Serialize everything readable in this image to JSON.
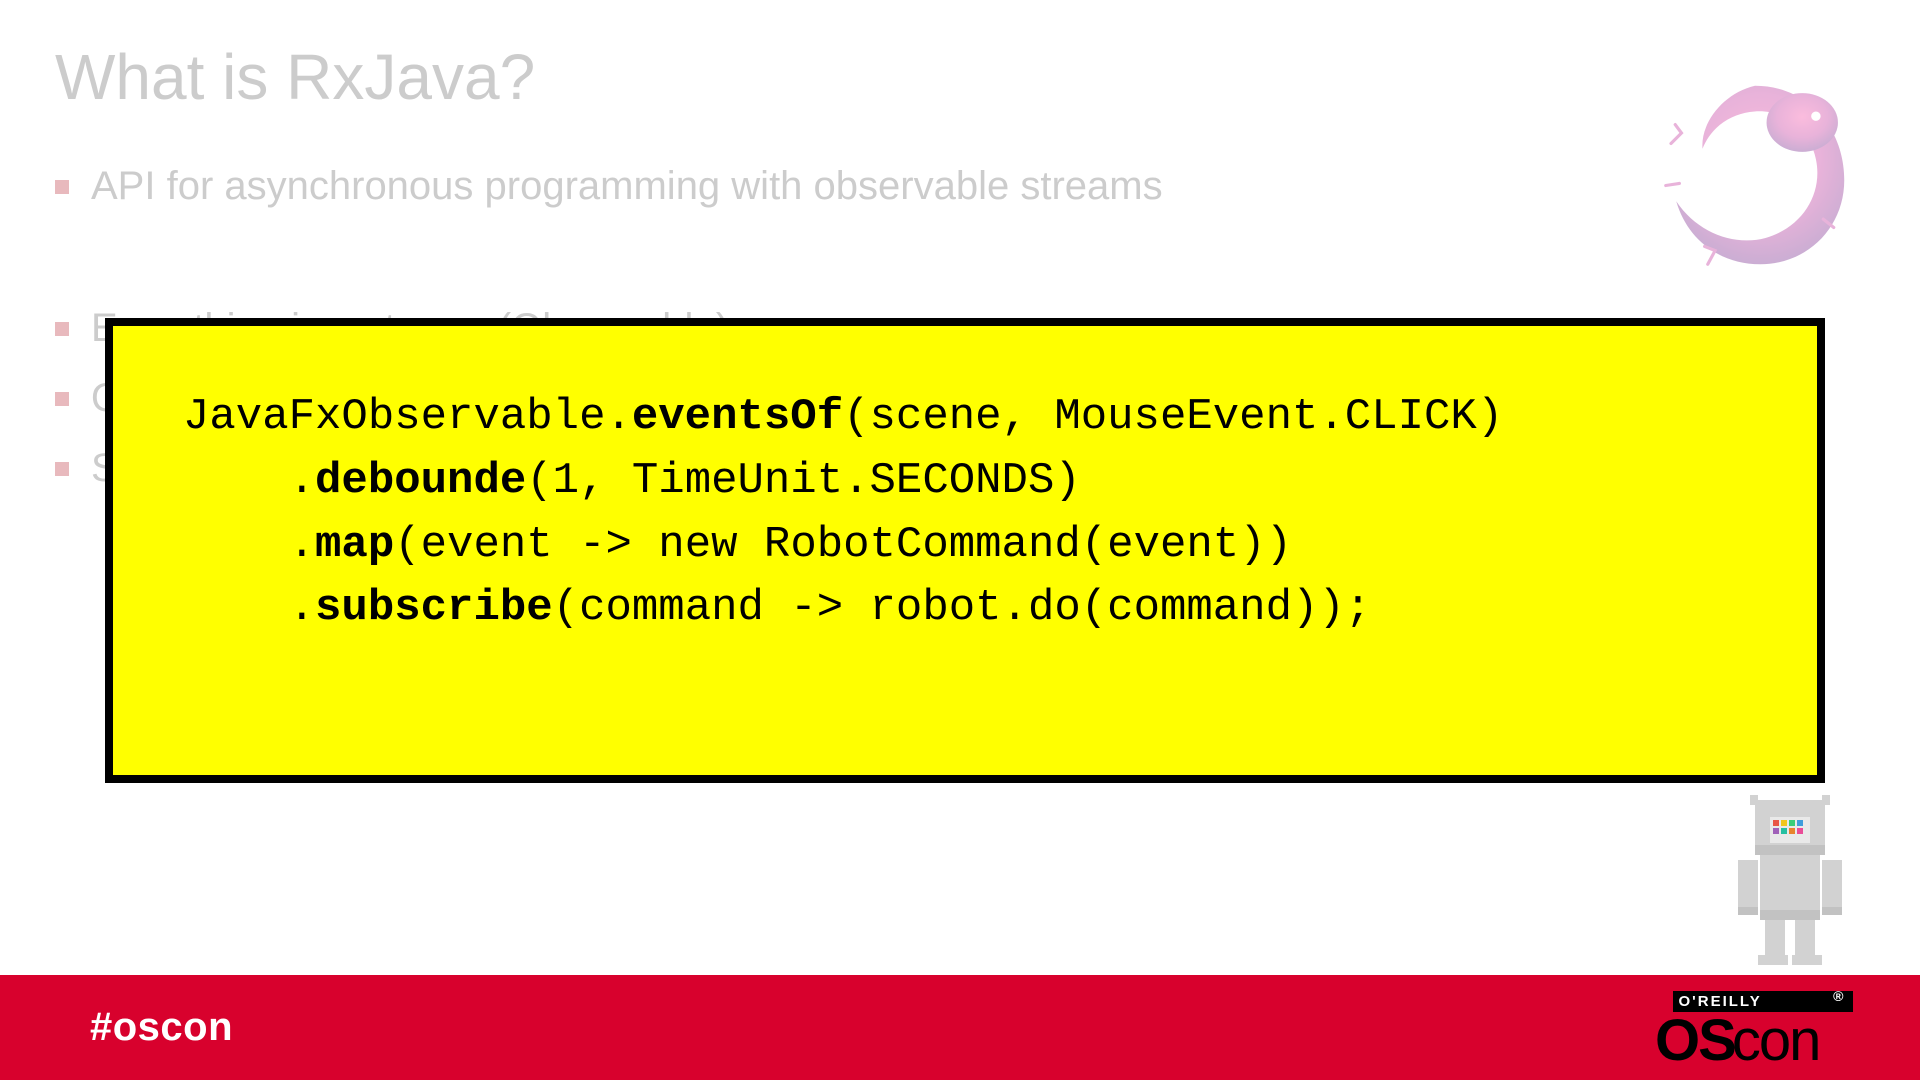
{
  "title": "What is RxJava?",
  "bullets": [
    "API for asynchronous programming with observable streams",
    "Everything is a stream (Observable)",
    "O",
    "S"
  ],
  "code": {
    "l1a": "JavaFxObservable.",
    "l1b": "eventsOf",
    "l1c": "(scene, MouseEvent.CLICK)",
    "l2a": "    .",
    "l2b": "debounde",
    "l2c": "(1, TimeUnit.SECONDS)",
    "l3a": "    .",
    "l3b": "map",
    "l3c": "(event -> new RobotCommand(event))",
    "l4a": "    .",
    "l4b": "subscribe",
    "l4c": "(command -> robot.do(command));"
  },
  "footer": {
    "hashtag": "#oscon",
    "publisher": "O'REILLY",
    "conference": "OSCON"
  },
  "icons": {
    "rx": "reactivex-logo",
    "robot": "pixel-robot-icon"
  }
}
